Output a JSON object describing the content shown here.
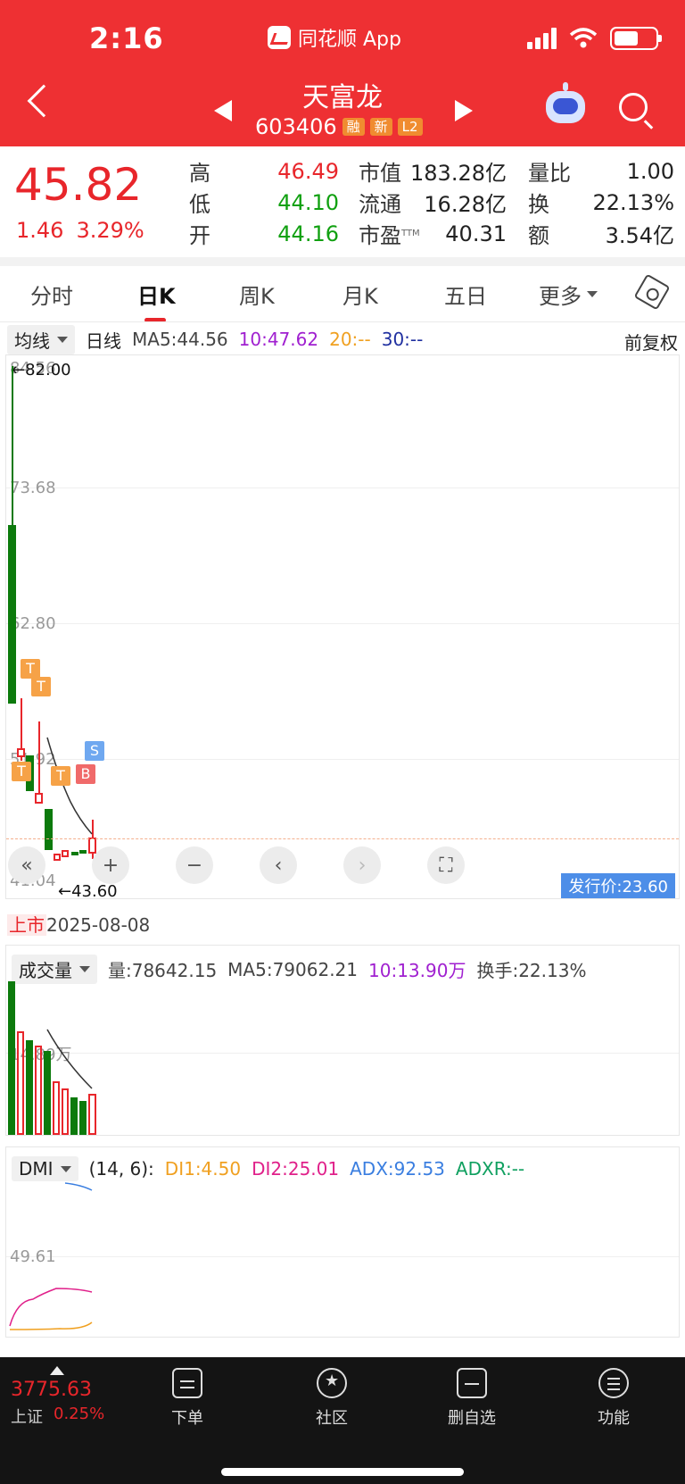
{
  "status_bar": {
    "time": "2:16",
    "app_name": "同花顺 App"
  },
  "header": {
    "name": "天富龙",
    "code": "603406",
    "tags": [
      "融",
      "新",
      "L2"
    ]
  },
  "quote": {
    "price": "45.82",
    "change": "1.46",
    "change_pct": "3.29%",
    "col1": [
      {
        "label": "高",
        "value": "46.49",
        "color": "red"
      },
      {
        "label": "低",
        "value": "44.10",
        "color": "green"
      },
      {
        "label": "开",
        "value": "44.16",
        "color": "green"
      }
    ],
    "col2": [
      {
        "label": "市值",
        "value": "183.28亿"
      },
      {
        "label": "流通",
        "value": "16.28亿"
      },
      {
        "label": "市盈",
        "sup": "TTM",
        "value": "40.31"
      }
    ],
    "col3": [
      {
        "label": "量比",
        "value": "1.00"
      },
      {
        "label": "换",
        "value": "22.13%"
      },
      {
        "label": "额",
        "value": "3.54亿"
      }
    ]
  },
  "tabs": [
    "分时",
    "日K",
    "周K",
    "月K",
    "五日",
    "更多"
  ],
  "active_tab": "日K",
  "legend": {
    "ma_type": "均线",
    "period": "日线",
    "ma5": "MA5:44.56",
    "ma10": "10:47.62",
    "ma20": "20:--",
    "ma30": "30:--",
    "adjust": "前复权"
  },
  "chart": {
    "y_labels": [
      "84.56",
      "73.68",
      "62.80",
      "51.92",
      "41.04"
    ],
    "high_label": "←82.00",
    "low_label": "←43.60",
    "issue_price": "发行价:23.60",
    "markers": [
      "T",
      "T",
      "T",
      "T",
      "B",
      "S"
    ]
  },
  "listing": {
    "mark": "上市",
    "date": "2025-08-08"
  },
  "volume": {
    "selector": "成交量",
    "vol": "量:78642.15",
    "ma5": "MA5:79062.21",
    "ma10": "10:13.90万",
    "turnover": "换手:22.13%",
    "y_label": "14.89万"
  },
  "dmi": {
    "selector": "DMI",
    "params": "(14, 6):",
    "di1": "DI1:4.50",
    "di2": "DI2:25.01",
    "adx": "ADX:92.53",
    "adxr": "ADXR:--",
    "y_label": "49.61"
  },
  "bottom": {
    "index_value": "3775.63",
    "index_name": "上证",
    "index_pct": "0.25%",
    "items": [
      "下单",
      "社区",
      "删自选",
      "功能"
    ]
  },
  "colors": {
    "up": "#e8262b",
    "down": "#0c7a0c",
    "brand": "#ee3033"
  }
}
